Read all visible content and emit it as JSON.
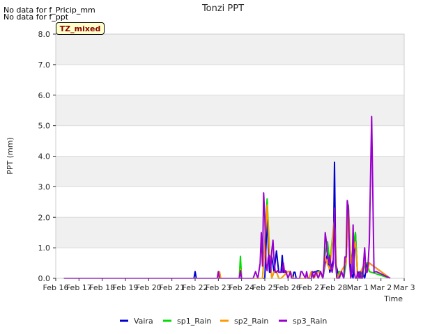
{
  "notes": [
    "No data for f_Pricip_mm",
    "No data for f_ppt"
  ],
  "badge": "TZ_mixed",
  "chart_data": {
    "type": "line",
    "title": "Tonzi PPT",
    "xlabel": "Time",
    "ylabel": "PPT (mm)",
    "ylim": [
      0,
      8
    ],
    "yticks": [
      "0.0",
      "1.0",
      "2.0",
      "3.0",
      "4.0",
      "5.0",
      "6.0",
      "7.0",
      "8.0"
    ],
    "xlim": [
      0,
      15
    ],
    "xticks": [
      "Feb 16",
      "Feb 17",
      "Feb 18",
      "Feb 19",
      "Feb 20",
      "Feb 21",
      "Feb 22",
      "Feb 23",
      "Feb 24",
      "Feb 25",
      "Feb 26",
      "Feb 27",
      "Feb 28",
      "Mar 1",
      "Mar 2",
      "Mar 3"
    ],
    "grid": true,
    "legend_position": "bottom",
    "series": [
      {
        "name": "Vaira",
        "color": "#0000cc",
        "x": [
          0.35,
          5.95,
          6.0,
          6.05,
          8.85,
          9.0,
          9.1,
          9.2,
          9.25,
          9.3,
          9.4,
          9.5,
          9.6,
          9.7,
          9.75,
          9.8,
          9.9,
          10.0,
          10.1,
          10.2,
          10.25,
          10.3,
          10.35,
          10.9,
          11.0,
          11.1,
          11.3,
          11.4,
          11.5,
          11.6,
          11.7,
          11.8,
          11.95,
          12.0,
          12.05,
          12.2,
          12.3,
          12.4,
          12.5,
          12.6,
          12.7,
          12.8,
          12.9,
          13.0,
          13.05,
          13.1,
          13.2,
          13.3,
          13.4,
          13.5,
          14.4
        ],
        "y": [
          0,
          0,
          0.22,
          0,
          0,
          0,
          2.0,
          0.2,
          0.7,
          0.7,
          0.2,
          0.9,
          0.2,
          0.2,
          0.75,
          0.2,
          0.2,
          0.22,
          0.22,
          0,
          0.2,
          0.2,
          0,
          0,
          0.2,
          0.2,
          0.25,
          0.22,
          0,
          0.5,
          0.8,
          0.2,
          0.6,
          3.8,
          0.5,
          0,
          0.22,
          0,
          0.6,
          2.2,
          0.22,
          0,
          1.5,
          0,
          0.2,
          0,
          0.22,
          0,
          0.5,
          0.5,
          0
        ]
      },
      {
        "name": "sp1_Rain",
        "color": "#00dd00",
        "x": [
          0.35,
          7.0,
          7.05,
          7.1,
          7.9,
          7.95,
          8.0,
          8.9,
          9.0,
          9.1,
          9.2,
          9.3,
          9.4,
          9.5,
          9.6,
          9.7,
          10.0,
          10.1,
          10.2,
          10.9,
          11.0,
          11.1,
          11.3,
          11.4,
          11.5,
          11.6,
          11.7,
          11.8,
          12.0,
          12.1,
          12.2,
          12.3,
          12.4,
          12.5,
          12.6,
          12.7,
          12.9,
          13.0,
          13.1,
          13.2,
          13.3,
          13.4,
          13.5,
          14.4
        ],
        "y": [
          0,
          0,
          0.22,
          0,
          0,
          0.72,
          0,
          0,
          1.2,
          2.6,
          0.9,
          0,
          0.22,
          0.22,
          0,
          0,
          0.22,
          0.22,
          0,
          0,
          0.22,
          0,
          0.22,
          0.22,
          0,
          0.8,
          1.2,
          0.5,
          2.0,
          0,
          0.22,
          0.22,
          0,
          0.5,
          2.4,
          0.5,
          1.5,
          0,
          0.22,
          0,
          0.5,
          0.5,
          0.22,
          0
        ]
      },
      {
        "name": "sp2_Rain",
        "color": "#ff9900",
        "x": [
          0.35,
          7.0,
          7.05,
          7.1,
          7.9,
          7.95,
          8.0,
          8.9,
          9.0,
          9.1,
          9.2,
          9.3,
          9.4,
          9.5,
          9.6,
          9.7,
          10.0,
          10.1,
          10.2,
          10.9,
          11.0,
          11.1,
          11.3,
          11.4,
          11.5,
          11.6,
          11.7,
          11.8,
          12.0,
          12.1,
          12.5,
          12.6,
          12.7,
          12.9,
          13.0,
          13.3,
          13.4,
          13.5,
          14.4
        ],
        "y": [
          0,
          0,
          0.22,
          0,
          0,
          0.3,
          0,
          0,
          1.0,
          2.4,
          0.8,
          0,
          0.22,
          0.22,
          0,
          0,
          0.22,
          0.22,
          0,
          0,
          0.22,
          0,
          0.2,
          0.2,
          0,
          0.7,
          0.45,
          0.3,
          2.0,
          0,
          0.5,
          2.3,
          0.5,
          1.2,
          0,
          0.5,
          0.2,
          0.5,
          0
        ]
      },
      {
        "name": "sp3_Rain",
        "color": "#9900cc",
        "x": [
          0.35,
          6.95,
          7.0,
          7.05,
          7.9,
          7.95,
          8.0,
          8.5,
          8.6,
          8.7,
          8.8,
          8.85,
          8.9,
          8.95,
          9.0,
          9.05,
          9.1,
          9.15,
          9.2,
          9.25,
          9.3,
          9.35,
          9.4,
          9.45,
          9.5,
          9.55,
          9.6,
          9.65,
          9.7,
          9.75,
          9.8,
          9.85,
          9.9,
          10.0,
          10.1,
          10.15,
          10.2,
          10.5,
          10.55,
          10.6,
          10.75,
          10.8,
          10.85,
          11.0,
          11.05,
          11.1,
          11.2,
          11.3,
          11.4,
          11.5,
          11.55,
          11.6,
          11.65,
          11.7,
          11.75,
          11.8,
          11.85,
          11.9,
          11.95,
          12.0,
          12.05,
          12.1,
          12.2,
          12.3,
          12.4,
          12.45,
          12.5,
          12.55,
          12.6,
          12.65,
          12.7,
          12.75,
          12.8,
          12.85,
          12.9,
          12.95,
          13.0,
          13.05,
          13.1,
          13.15,
          13.2,
          13.25,
          13.3,
          13.35,
          13.4,
          13.45,
          13.5,
          13.6,
          13.7,
          13.8,
          14.4
        ],
        "y": [
          0,
          0,
          0.22,
          0,
          0,
          0.25,
          0,
          0,
          0.22,
          0,
          0.5,
          1.5,
          0.4,
          2.8,
          2.0,
          0.5,
          0.25,
          0.7,
          0.75,
          0.2,
          0.9,
          1.25,
          0.6,
          0.2,
          0.2,
          0.25,
          0.2,
          0.2,
          0.22,
          0.2,
          0.5,
          0.2,
          0.25,
          0,
          0.22,
          0,
          0,
          0,
          0.22,
          0.22,
          0,
          0.22,
          0,
          0,
          0.22,
          0,
          0.22,
          0,
          0.22,
          0,
          0.5,
          1.5,
          1.2,
          0.7,
          0.5,
          0.75,
          0.3,
          0.2,
          0.5,
          2.3,
          0.5,
          0,
          0,
          0.22,
          0,
          0.7,
          0.7,
          2.55,
          2.3,
          0.5,
          0,
          0.2,
          1.75,
          0.2,
          0,
          0,
          0.22,
          0,
          0.22,
          0,
          0,
          0.5,
          1.0,
          0.2,
          0.2,
          0.5,
          1.2,
          5.3,
          0.2,
          0.22,
          0
        ]
      }
    ]
  }
}
